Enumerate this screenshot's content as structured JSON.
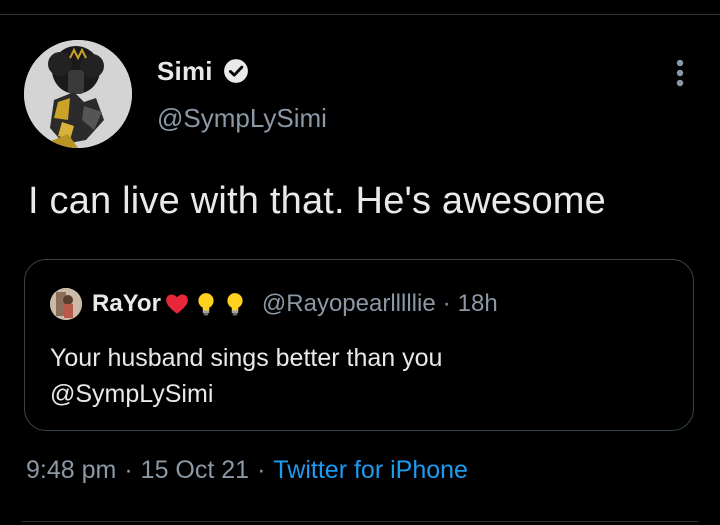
{
  "tweet": {
    "author": {
      "name": "Simi",
      "handle": "@SympLySimi",
      "verified": true,
      "avatar_icon": "profile-photo"
    },
    "text": "I can live with that. He's awesome",
    "more_icon": "more-vertical-icon",
    "quoted": {
      "name": "RaYor",
      "name_emojis": [
        "red-heart",
        "light-bulb",
        "light-bulb"
      ],
      "handle": "@Rayopearlllllie",
      "separator": "·",
      "time": "18h",
      "body_line1": "Your husband sings better than you",
      "body_line2": "@SympLySimi"
    },
    "meta": {
      "time": "9:48 pm",
      "separator": "·",
      "date": "15 Oct 21",
      "source": "Twitter for iPhone"
    }
  },
  "colors": {
    "background": "#000000",
    "primary_text": "#e7e9ea",
    "secondary_text": "#8b98a5",
    "link": "#1d9bf0",
    "border": "#38444d"
  }
}
